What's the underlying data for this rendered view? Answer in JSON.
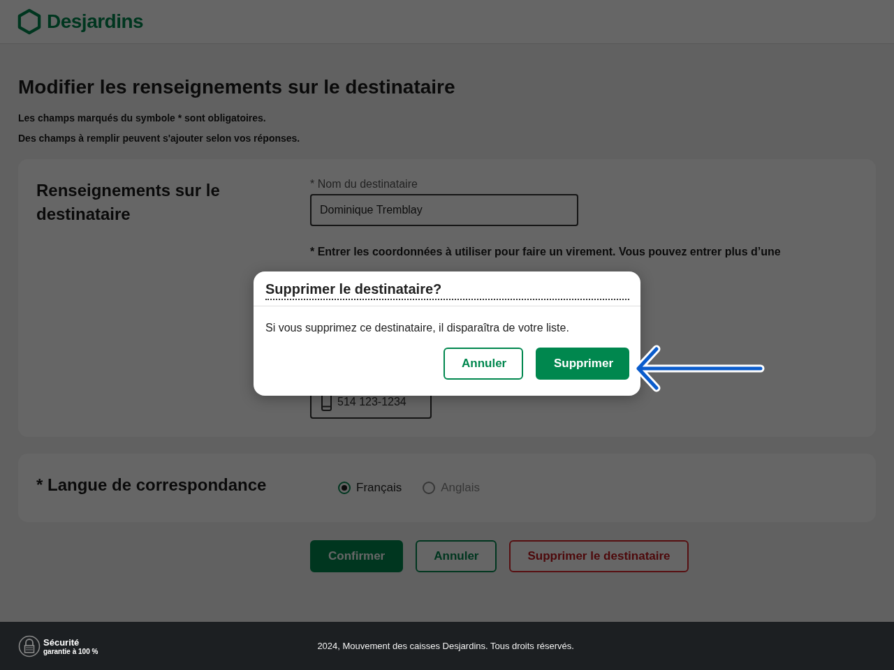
{
  "header": {
    "brand": "Desjardins"
  },
  "page": {
    "title": "Modifier les renseignements sur le destinataire",
    "notes": [
      "Les champs marqués du symbole * sont obligatoires.",
      "Des champs à remplir peuvent s'ajouter selon vos réponses."
    ]
  },
  "recipient_section": {
    "heading": "Renseignements sur le destinataire",
    "name_field": {
      "label": "* Nom du destinataire",
      "value": "Dominique Tremblay"
    },
    "instruction": "* Entrer les coordonnées à utiliser pour faire un virement. Vous pouvez entrer plus d’une",
    "phone": "514 123-1234"
  },
  "language_section": {
    "heading": "* Langue de correspondance",
    "options": [
      {
        "label": "Français",
        "selected": true
      },
      {
        "label": "Anglais",
        "selected": false
      }
    ]
  },
  "actions": [
    {
      "label": "Confirmer",
      "kind": "primary"
    },
    {
      "label": "Annuler",
      "kind": "secondary"
    },
    {
      "label": "Supprimer le destinataire",
      "kind": "danger"
    }
  ],
  "dialog": {
    "title": "Supprimer le destinataire?",
    "message": "Si vous supprimez ce destinataire, il disparaîtra de votre liste.",
    "buttons": [
      {
        "label": "Annuler",
        "kind": "secondary"
      },
      {
        "label": "Supprimer",
        "kind": "primary"
      }
    ]
  },
  "footer": {
    "security_title": "Sécurité",
    "security_subtitle": "garantie à 100 %",
    "copyright": "2024, Mouvement des caisses Desjardins. Tous droits réservés."
  }
}
